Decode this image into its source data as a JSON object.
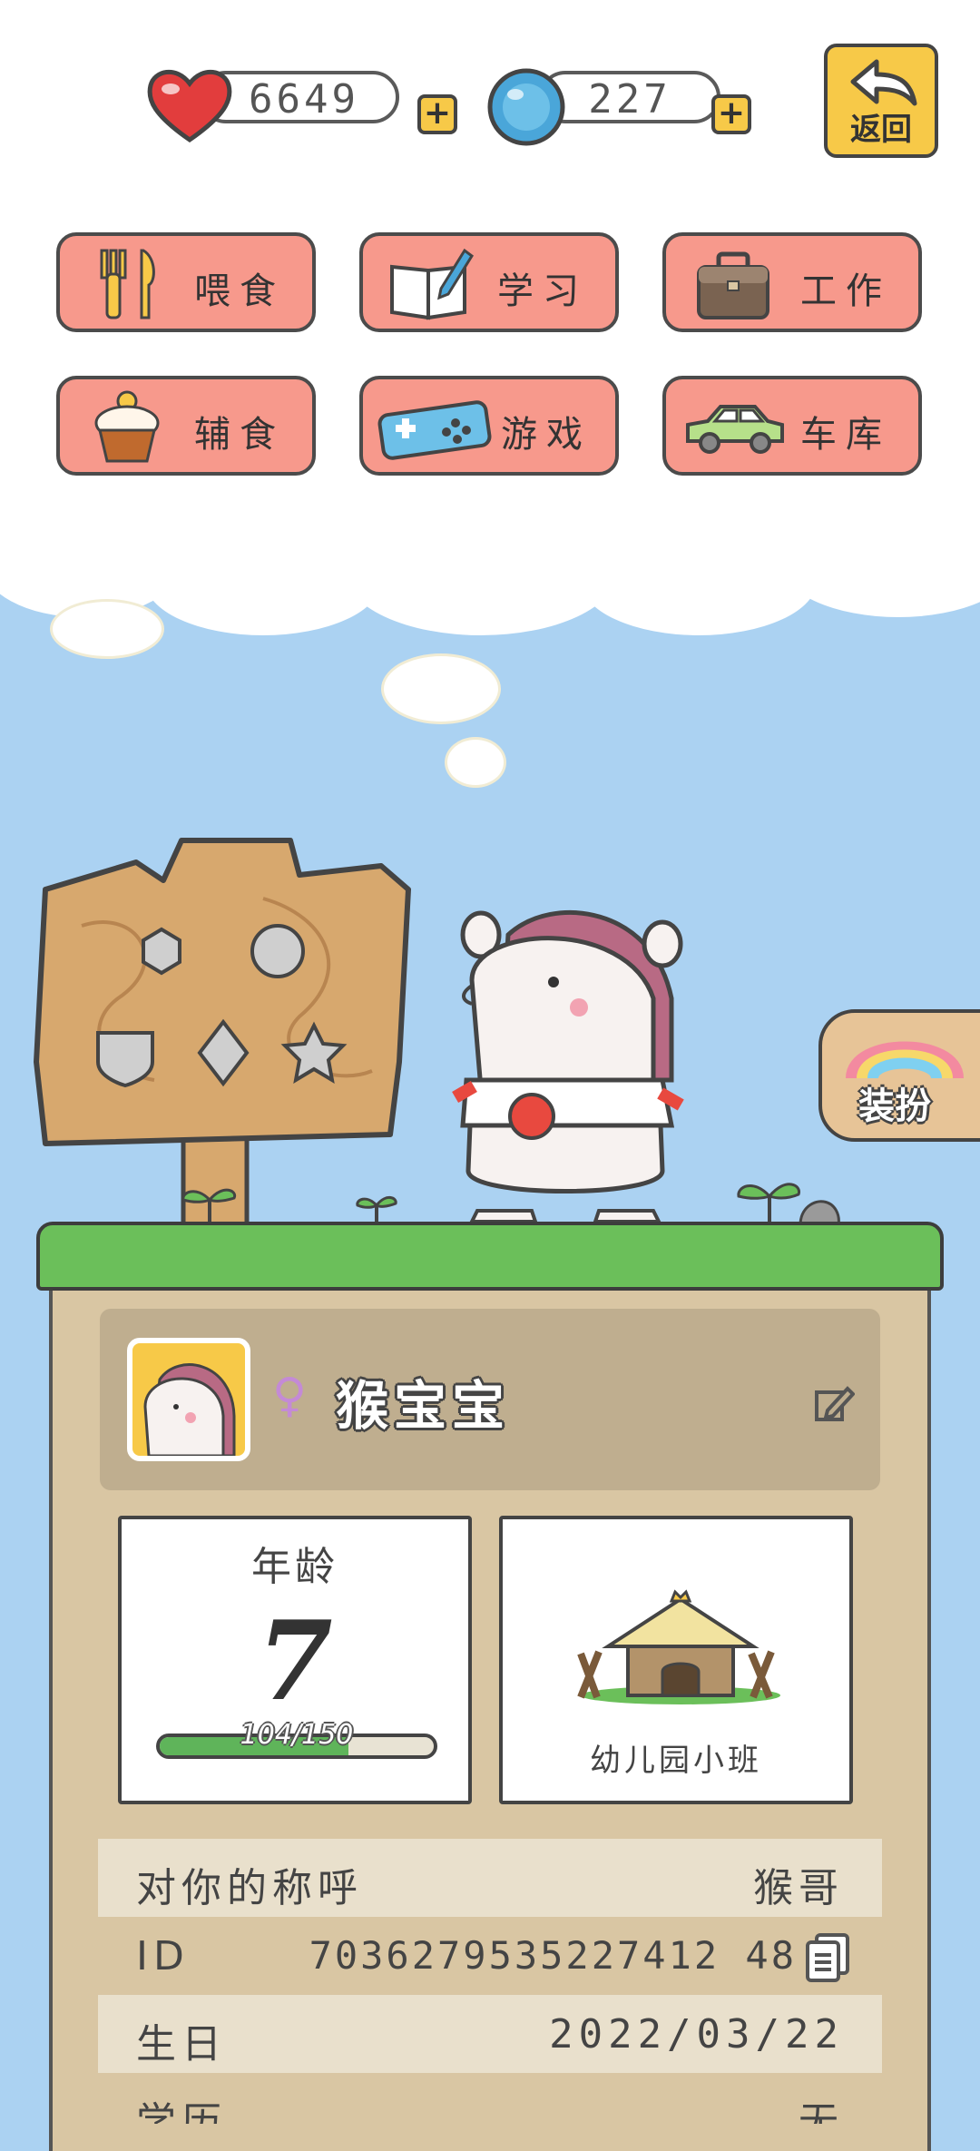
{
  "header": {
    "hearts": {
      "value": "6649",
      "icon": "heart-icon"
    },
    "gems": {
      "value": "227",
      "icon": "blue-gem-icon"
    },
    "plus": "+",
    "back_label": "返回"
  },
  "menu": [
    {
      "label": "喂食",
      "icon": "fork-knife-icon"
    },
    {
      "label": "学习",
      "icon": "book-pen-icon"
    },
    {
      "label": "工作",
      "icon": "briefcase-icon"
    },
    {
      "label": "辅食",
      "icon": "cupcake-icon"
    },
    {
      "label": "游戏",
      "icon": "gamepad-icon"
    },
    {
      "label": "车库",
      "icon": "car-icon"
    }
  ],
  "dressup_label": "装扮",
  "profile": {
    "gender_symbol": "♀",
    "name": "猴宝宝"
  },
  "age": {
    "label": "年龄",
    "value": "7",
    "progress_text": "104/150",
    "progress_fraction": 0.69
  },
  "school": {
    "label": "幼儿园小班",
    "icon": "hut-icon"
  },
  "info": {
    "nickname_key": "对你的称呼",
    "nickname_value": "猴哥",
    "id_key": "ID",
    "id_value": "7036279535227412 48",
    "birthday_key": "生日",
    "birthday_value": "2022/03/22",
    "education_key": "学历",
    "education_value": "无"
  },
  "colors": {
    "sky": "#abd2f2",
    "button": "#f7998c",
    "accent_yellow": "#f7c948",
    "grass": "#6bbf5a",
    "panel": "#d9c6a3"
  }
}
